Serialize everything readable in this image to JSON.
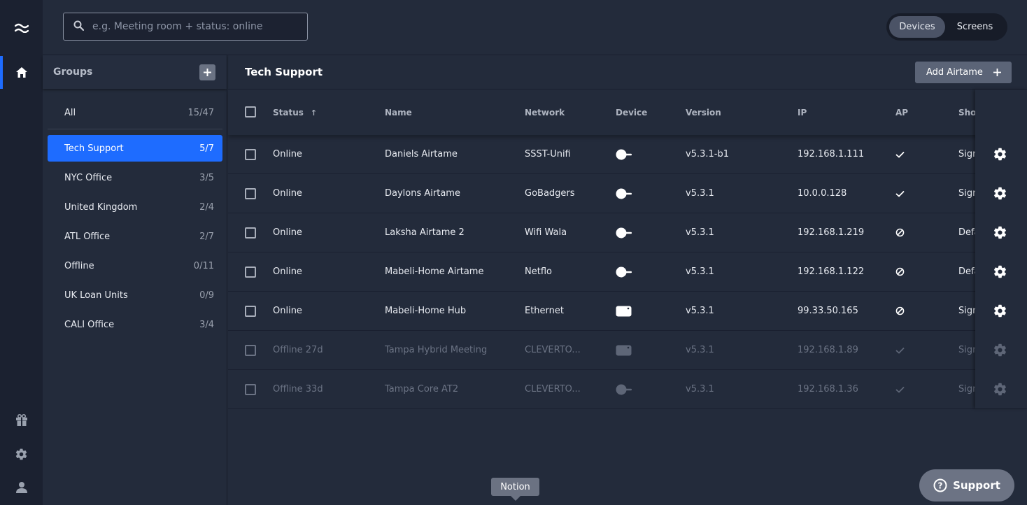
{
  "rail": {
    "icons": [
      "airtame-logo-icon",
      "home-icon",
      "gift-icon",
      "settings-icon",
      "user-icon"
    ]
  },
  "search": {
    "placeholder": "e.g. Meeting room + status: online"
  },
  "view_toggle": {
    "devices": "Devices",
    "screens": "Screens",
    "selected": "Devices"
  },
  "groups": {
    "title": "Groups",
    "all": {
      "label": "All",
      "count": "15/47"
    },
    "items": [
      {
        "label": "Tech Support",
        "count": "5/7",
        "active": true
      },
      {
        "label": "NYC Office",
        "count": "3/5"
      },
      {
        "label": "United Kingdom",
        "count": "2/4"
      },
      {
        "label": "ATL Office",
        "count": "2/7"
      },
      {
        "label": "Offline",
        "count": "0/11"
      },
      {
        "label": "UK Loan Units",
        "count": "0/9"
      },
      {
        "label": "CALI Office",
        "count": "3/4"
      }
    ]
  },
  "main": {
    "title": "Tech Support",
    "add_button": "Add Airtame"
  },
  "table": {
    "columns": {
      "status": "Status",
      "name": "Name",
      "network": "Network",
      "device": "Device",
      "version": "Version",
      "ip": "IP",
      "ap": "AP",
      "show": "Sho"
    },
    "rows": [
      {
        "status": "Online",
        "name": "Daniels Airtame",
        "network": "SSST-Unifi",
        "device": "dongle",
        "version": "v5.3.1-b1",
        "ip": "192.168.1.111",
        "ap": "check",
        "show": "Sign",
        "online": true
      },
      {
        "status": "Online",
        "name": "Daylons Airtame",
        "network": "GoBadgers",
        "device": "dongle",
        "version": "v5.3.1",
        "ip": "10.0.0.128",
        "ap": "check",
        "show": "Sign",
        "online": true
      },
      {
        "status": "Online",
        "name": "Laksha Airtame 2",
        "network": "Wifi Wala",
        "device": "dongle",
        "version": "v5.3.1",
        "ip": "192.168.1.219",
        "ap": "disabled",
        "show": "Defa",
        "online": true
      },
      {
        "status": "Online",
        "name": "Mabeli-Home Airtame",
        "network": "Netflo",
        "device": "dongle",
        "version": "v5.3.1",
        "ip": "192.168.1.122",
        "ap": "disabled",
        "show": "Defa",
        "online": true
      },
      {
        "status": "Online",
        "name": "Mabeli-Home Hub",
        "network": "Ethernet",
        "device": "hub",
        "version": "v5.3.1",
        "ip": "99.33.50.165",
        "ap": "disabled",
        "show": "Sign",
        "online": true
      },
      {
        "status": "Offline 27d",
        "name": "Tampa Hybrid Meeting",
        "network": "CLEVERTO...",
        "device": "hub",
        "version": "v5.3.1",
        "ip": "192.168.1.89",
        "ap": "check",
        "show": "Sign",
        "online": false
      },
      {
        "status": "Offline 33d",
        "name": "Tampa Core AT2",
        "network": "CLEVERTO...",
        "device": "dongle",
        "version": "v5.3.1",
        "ip": "192.168.1.36",
        "ap": "check",
        "show": "Sign",
        "online": false
      }
    ]
  },
  "tooltip": "Notion",
  "support": "Support",
  "colors": {
    "accent": "#1e6cff",
    "background": "#232b3b",
    "rail": "#1b2130"
  }
}
